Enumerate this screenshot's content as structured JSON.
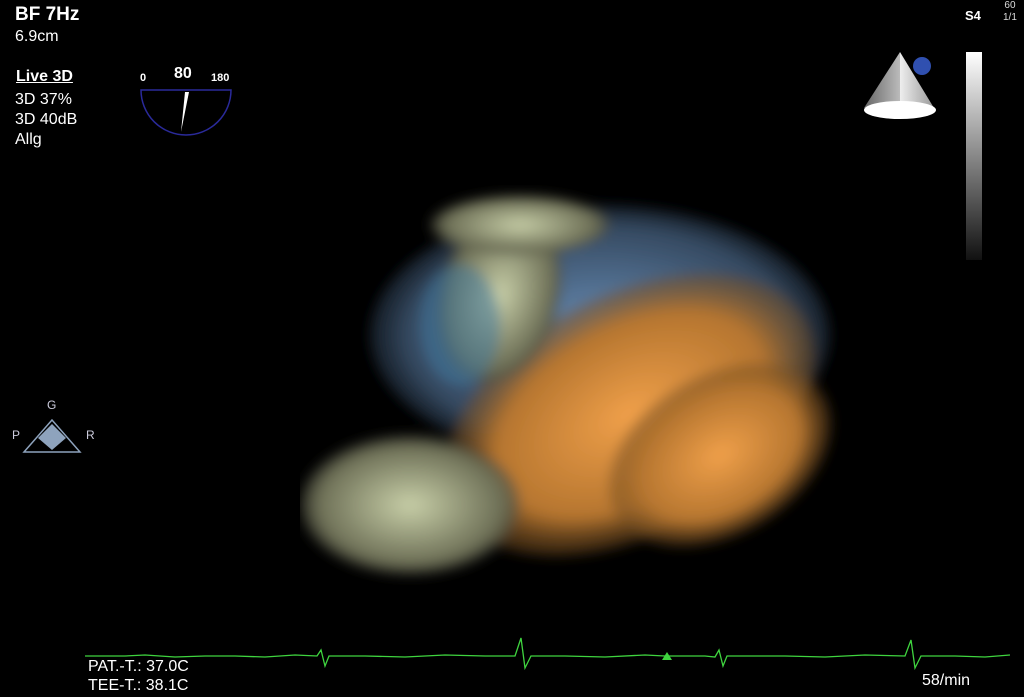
{
  "header": {
    "line1": "BF 7Hz",
    "line2": "6.9cm"
  },
  "settings": {
    "mode": "Live 3D",
    "lines": [
      "3D 37%",
      "3D 40dB",
      "Allg"
    ]
  },
  "angle_indicator": {
    "min": "0",
    "value": "80",
    "max": "180"
  },
  "top_right": {
    "preset": "S4",
    "frame_rate": "60",
    "frame_index": "1/1"
  },
  "orientation": {
    "top": "G",
    "left": "P",
    "right": "R"
  },
  "footer": {
    "patient_temp": "PAT.-T.: 37.0C",
    "tee_temp": "TEE-T.: 38.1C",
    "heart_rate": "58/min"
  },
  "colors": {
    "background": "#000000",
    "ecg": "#3fd43f",
    "tissue_warm": "#d88a2e",
    "tissue_cool": "#5d7fa6",
    "probe_dot": "#3050b0"
  }
}
